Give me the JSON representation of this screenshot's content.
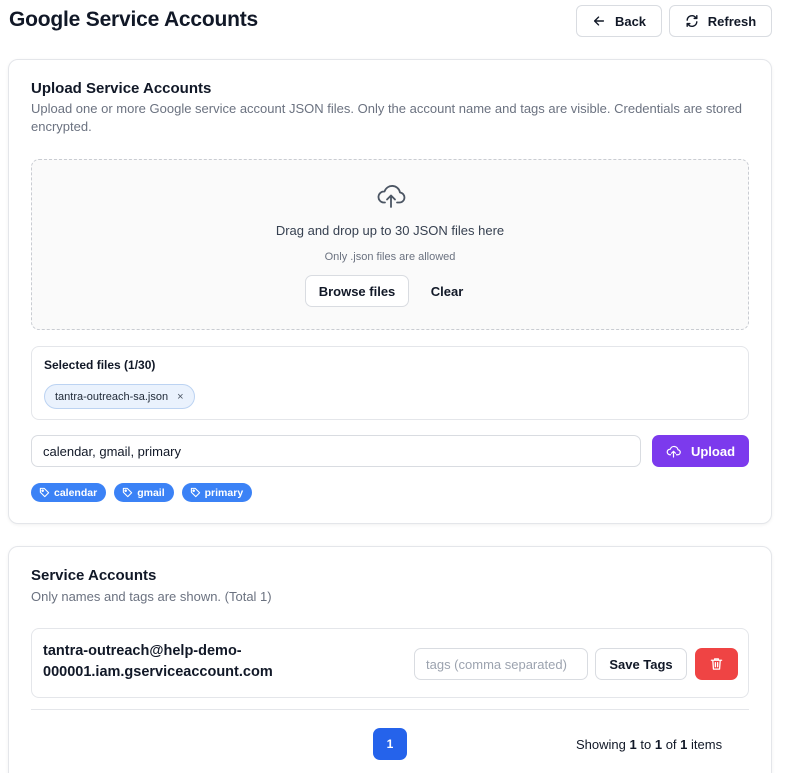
{
  "header": {
    "title": "Google Service Accounts",
    "back_label": "Back",
    "refresh_label": "Refresh"
  },
  "upload": {
    "title": "Upload Service Accounts",
    "description": "Upload one or more Google service account JSON files. Only the account name and tags are visible. Credentials are stored encrypted.",
    "dropzone": {
      "title": "Drag and drop up to 30 JSON files here",
      "subtitle": "Only .json files are allowed",
      "browse_label": "Browse files",
      "clear_label": "Clear"
    },
    "selected": {
      "title": "Selected files (1/30)",
      "files": [
        "tantra-outreach-sa.json"
      ],
      "remove_glyph": "×"
    },
    "tags_value": "calendar, gmail, primary",
    "upload_label": "Upload",
    "tags": [
      "calendar",
      "gmail",
      "primary"
    ]
  },
  "accounts": {
    "title": "Service Accounts",
    "description": "Only names and tags are shown. (Total 1)",
    "rows": [
      {
        "name": "tantra-outreach@help-demo-000001.iam.gserviceaccount.com",
        "tags_placeholder": "tags (comma separated)",
        "save_label": "Save Tags"
      }
    ],
    "pagination": {
      "current_page": "1",
      "showing_prefix": "Showing",
      "from": "1",
      "to_word": "to",
      "to": "1",
      "of_word": "of",
      "total": "1",
      "suffix": "items"
    }
  },
  "colors": {
    "primary_purple": "#7c3aed",
    "tag_blue": "#3b82f6",
    "page_blue": "#2563eb",
    "danger_red": "#ef4444"
  },
  "icons": {
    "back": "arrow-left-icon",
    "refresh": "refresh-icon",
    "dropzone": "cloud-upload-icon",
    "upload": "cloud-upload-icon",
    "tag": "tag-icon",
    "delete": "trash-icon"
  }
}
